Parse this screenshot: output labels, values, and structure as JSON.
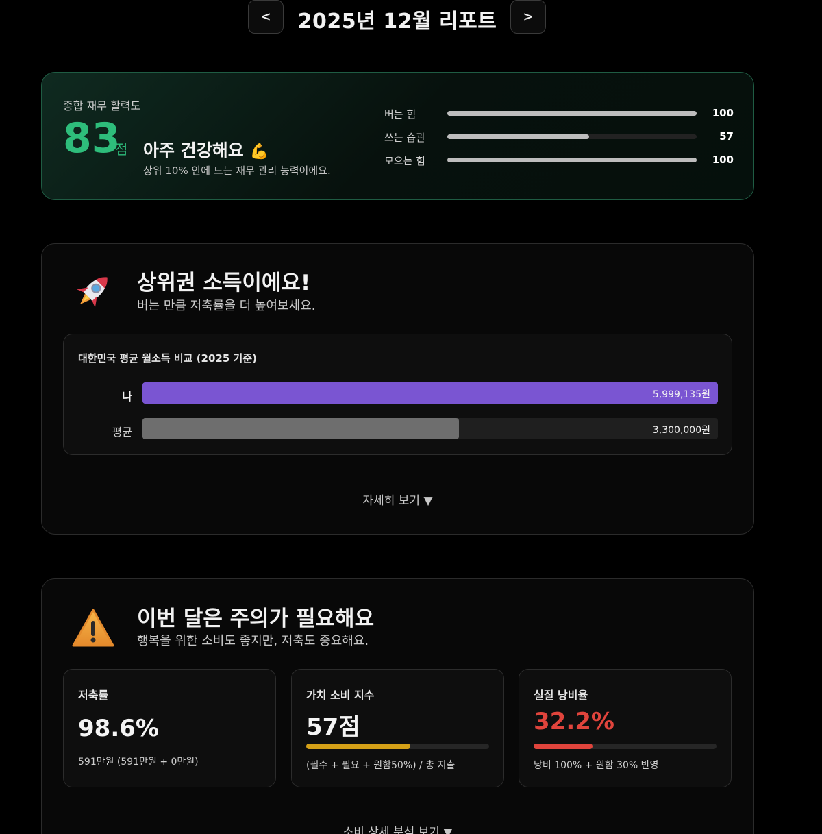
{
  "header": {
    "prev_label": "<",
    "title": "2025년 12월 리포트",
    "next_label": ">"
  },
  "score": {
    "label": "종합 재무 활력도",
    "value": "83",
    "unit": "점",
    "status": "아주 건강해요",
    "status_emoji": "💪",
    "subtitle": "상위 10% 안에 드는 재무 관리 능력이에요.",
    "metrics": [
      {
        "label": "버는 힘",
        "value": "100",
        "fraction": 1.0
      },
      {
        "label": "쓰는 습관",
        "value": "57",
        "fraction": 0.57
      },
      {
        "label": "모으는 힘",
        "value": "100",
        "fraction": 1.0
      }
    ],
    "accent_color": "#2ebd7b"
  },
  "income": {
    "icon": "rocket-icon",
    "title": "상위권 소득이에요!",
    "subtitle": "버는 만큼 저축률을 더 높여보세요.",
    "compare_title": "대한민국 평균 월소득 비교 (2025 기준)",
    "bars": [
      {
        "label": "나",
        "value": "5,999,135원",
        "fraction": 1.0,
        "color": "#7a55d2"
      },
      {
        "label": "평균",
        "value": "3,300,000원",
        "fraction": 0.55,
        "color": "#6e6e6e"
      }
    ],
    "more_label": "자세히 보기 ▼"
  },
  "warning": {
    "icon": "warning-icon",
    "title": "이번 달은 주의가 필요해요",
    "subtitle": "행복을 위한 소비도 좋지만, 저축도 중요해요.",
    "stats": [
      {
        "label": "저축률",
        "value": "98.6%",
        "note": "591만원 (591만원 + 0만원)",
        "color": "#f4f4f4"
      },
      {
        "label": "가치 소비 지수",
        "value": "57점",
        "note": "(필수 + 필요 + 원함50%) / 총 지출",
        "fraction": 0.57,
        "color": "#d4a017"
      },
      {
        "label": "실질 낭비율",
        "value": "32.2%",
        "note": "낭비 100% + 원함 30% 반영",
        "fraction": 0.322,
        "color": "#e0443c"
      }
    ],
    "more_label": "소비 상세 분석 보기 ▼"
  }
}
